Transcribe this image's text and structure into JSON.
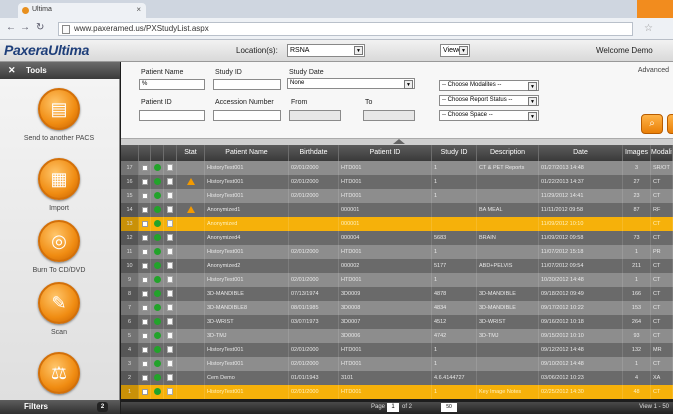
{
  "browser": {
    "tab_title": "Ultima",
    "url": "www.paxeramed.us/PXStudyList.aspx",
    "colors": {
      "accent": "#f28c1e"
    }
  },
  "app": {
    "logo": "PaxeraUltima",
    "location_label": "Location(s):",
    "location_value": "RSNA",
    "viewer_value": "Viewer",
    "welcome": "Welcome Demo"
  },
  "sidebar": {
    "title": "Tools",
    "tools": [
      {
        "label": "Send to another PACS",
        "icon": "send-icon"
      },
      {
        "label": "Import",
        "icon": "import-icon"
      },
      {
        "label": "Burn To CD/DVD",
        "icon": "disc-icon"
      },
      {
        "label": "Scan",
        "icon": "scan-icon"
      },
      {
        "label": "",
        "icon": "balance-icon"
      }
    ],
    "filters_label": "Filters",
    "filters_count": "2"
  },
  "search": {
    "patient_name_label": "Patient Name",
    "patient_name_value": "%",
    "study_id_label": "Study ID",
    "study_date_label": "Study Date",
    "study_date_value": "None",
    "patient_id_label": "Patient ID",
    "accession_label": "Accession Number",
    "from_label": "From",
    "to_label": "To",
    "modalities": "-- Choose Modalites --",
    "report_status": "-- Choose Report Status --",
    "space": "-- Choose Space --",
    "advanced": "Advanced"
  },
  "grid": {
    "headers": [
      "Stat",
      "Patient Name",
      "Birthdate",
      "Patient ID",
      "Study ID",
      "Description",
      "Date",
      "Images",
      "Modality"
    ],
    "rows": [
      {
        "n": "17",
        "status": "",
        "name": "HistoryTest001",
        "birth": "02/01/2000",
        "pid": "HTD001",
        "sid": "1",
        "desc": "CT & PET Reports",
        "date": "01/27/2013 14:48",
        "img": "3",
        "mod": "SR/OT",
        "tone": "light"
      },
      {
        "n": "16",
        "status": "warn",
        "name": "HistoryTest001",
        "birth": "02/01/2000",
        "pid": "HTD001",
        "sid": "1",
        "desc": "",
        "date": "01/22/2013 14:37",
        "img": "27",
        "mod": "CT",
        "tone": "dark"
      },
      {
        "n": "15",
        "status": "",
        "name": "HistoryTest001",
        "birth": "02/01/2000",
        "pid": "HTD001",
        "sid": "1",
        "desc": "",
        "date": "11/29/2012 14:41",
        "img": "23",
        "mod": "CT",
        "tone": "light"
      },
      {
        "n": "14",
        "status": "warn",
        "name": "Anonymized1",
        "birth": "",
        "pid": "000001",
        "sid": "",
        "desc": "BA MEAL",
        "date": "11/11/2012 09:58",
        "img": "87",
        "mod": "RF",
        "tone": "dark"
      },
      {
        "n": "13",
        "status": "",
        "name": "Anonymized",
        "birth": "",
        "pid": "000001",
        "sid": "",
        "desc": "",
        "date": "11/09/2012 10:10",
        "img": "",
        "mod": "CT",
        "tone": "sel"
      },
      {
        "n": "12",
        "status": "",
        "name": "Anonymized4",
        "birth": "",
        "pid": "000004",
        "sid": "5683",
        "desc": "BRAIN",
        "date": "11/09/2012 09:58",
        "img": "73",
        "mod": "CT",
        "tone": "dark"
      },
      {
        "n": "11",
        "status": "",
        "name": "HistoryTest001",
        "birth": "02/01/2000",
        "pid": "HTD001",
        "sid": "1",
        "desc": "",
        "date": "11/07/2012 15:18",
        "img": "1",
        "mod": "PR",
        "tone": "light"
      },
      {
        "n": "10",
        "status": "",
        "name": "Anonymized2",
        "birth": "",
        "pid": "000002",
        "sid": "5177",
        "desc": "ABD+PELVIS",
        "date": "11/07/2012 09:54",
        "img": "211",
        "mod": "CT",
        "tone": "dark"
      },
      {
        "n": "9",
        "status": "",
        "name": "HistoryTest001",
        "birth": "02/01/2000",
        "pid": "HTD001",
        "sid": "1",
        "desc": "",
        "date": "10/30/2012 14:48",
        "img": "1",
        "mod": "CT",
        "tone": "light"
      },
      {
        "n": "8",
        "status": "",
        "name": "3D-MANDIBLE",
        "birth": "07/13/1974",
        "pid": "3D0009",
        "sid": "4878",
        "desc": "3D-MANDIBLE",
        "date": "09/18/2012 09:49",
        "img": "166",
        "mod": "CT",
        "tone": "dark"
      },
      {
        "n": "7",
        "status": "",
        "name": "3D-MANDIBLE8",
        "birth": "08/01/1985",
        "pid": "3D0008",
        "sid": "4834",
        "desc": "3D-MANDIBLE",
        "date": "09/17/2012 10:22",
        "img": "153",
        "mod": "CT",
        "tone": "light"
      },
      {
        "n": "6",
        "status": "",
        "name": "3D-WRIST",
        "birth": "03/07/1973",
        "pid": "3D0007",
        "sid": "4512",
        "desc": "3D-WRIST",
        "date": "09/16/2012 10:18",
        "img": "264",
        "mod": "CT",
        "tone": "dark"
      },
      {
        "n": "5",
        "status": "",
        "name": "3D-TMJ",
        "birth": "",
        "pid": "3D0006",
        "sid": "4742",
        "desc": "3D-TMJ",
        "date": "09/15/2012 10:10",
        "img": "93",
        "mod": "CT",
        "tone": "light"
      },
      {
        "n": "4",
        "status": "",
        "name": "HistoryTest001",
        "birth": "02/01/2000",
        "pid": "HTD001",
        "sid": "1",
        "desc": "",
        "date": "09/12/2012 14:48",
        "img": "132",
        "mod": "MR",
        "tone": "dark"
      },
      {
        "n": "3",
        "status": "",
        "name": "HistoryTest001",
        "birth": "02/01/2000",
        "pid": "HTD001",
        "sid": "1",
        "desc": "",
        "date": "09/10/2012 14:48",
        "img": "1",
        "mod": "CT",
        "tone": "light"
      },
      {
        "n": "2",
        "status": "",
        "name": "Cem Demo",
        "birth": "01/01/1943",
        "pid": "3101",
        "sid": "4.6.4144727",
        "desc": "",
        "date": "03/06/2012 10:23",
        "img": "4",
        "mod": "XA",
        "tone": "dark"
      },
      {
        "n": "1",
        "status": "",
        "name": "HistoryTest001",
        "birth": "02/01/2000",
        "pid": "HTD001",
        "sid": "1",
        "desc": "Key Image Notes",
        "date": "02/25/2012 14:30",
        "img": "48",
        "mod": "CT",
        "tone": "sel"
      }
    ]
  },
  "footer": {
    "page_label": "Page",
    "page_value": "1",
    "of": "of 2",
    "per_page": "50",
    "view": "View 1 - 50"
  }
}
